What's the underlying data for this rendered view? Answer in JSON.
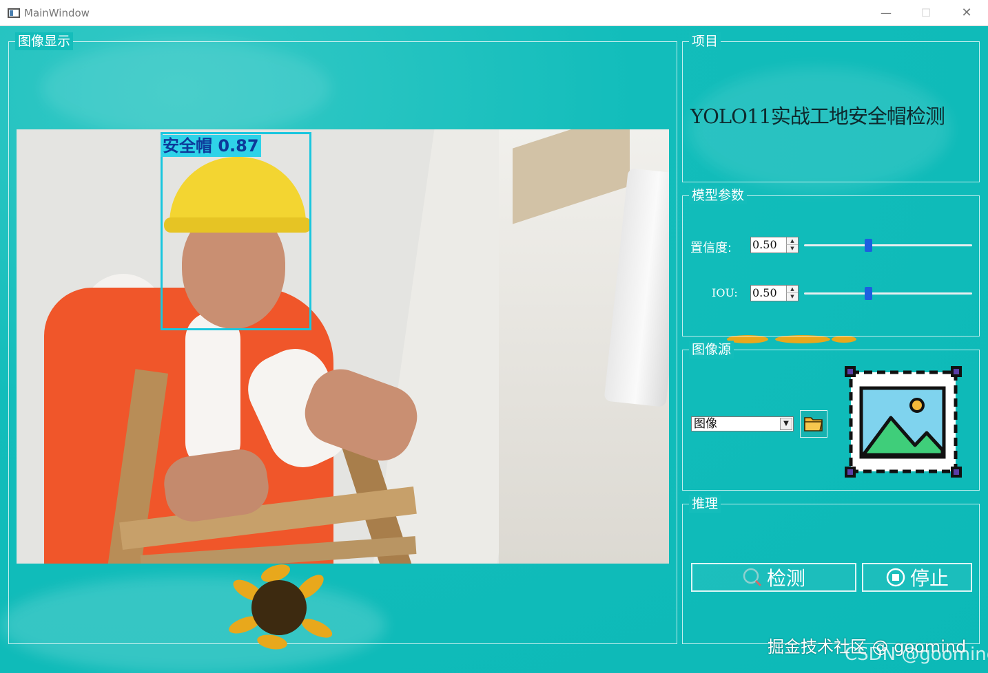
{
  "window": {
    "title": "MainWindow",
    "minimize_icon": "minimize-icon",
    "maximize_icon": "maximize-icon",
    "close_icon": "close-icon"
  },
  "image_display": {
    "group_title": "图像显示",
    "detection": {
      "label": "安全帽 0.87",
      "class": "安全帽",
      "confidence": 0.87,
      "box_color": "#19c6de"
    }
  },
  "project": {
    "group_title": "项目",
    "title": "YOLO11实战工地安全帽检测"
  },
  "model_params": {
    "group_title": "模型参数",
    "confidence": {
      "label": "置信度:",
      "value": "0.50",
      "slider_level": 0.38
    },
    "iou": {
      "label": "IOU:",
      "value": "0.50",
      "slider_level": 0.38
    }
  },
  "image_source": {
    "group_title": "图像源",
    "selected": "图像",
    "folder_icon": "folder-icon",
    "preview_icon": "image-icon"
  },
  "inference": {
    "group_title": "推理",
    "detect_label": "检测",
    "stop_label": "停止"
  },
  "watermarks": {
    "juejin": "掘金技术社区 @ goomind",
    "csdn": "CSDN @goomind"
  },
  "colors": {
    "background": "#12bdbb",
    "slider_handle": "#1c5fe0",
    "detection_box": "#19c6de"
  }
}
